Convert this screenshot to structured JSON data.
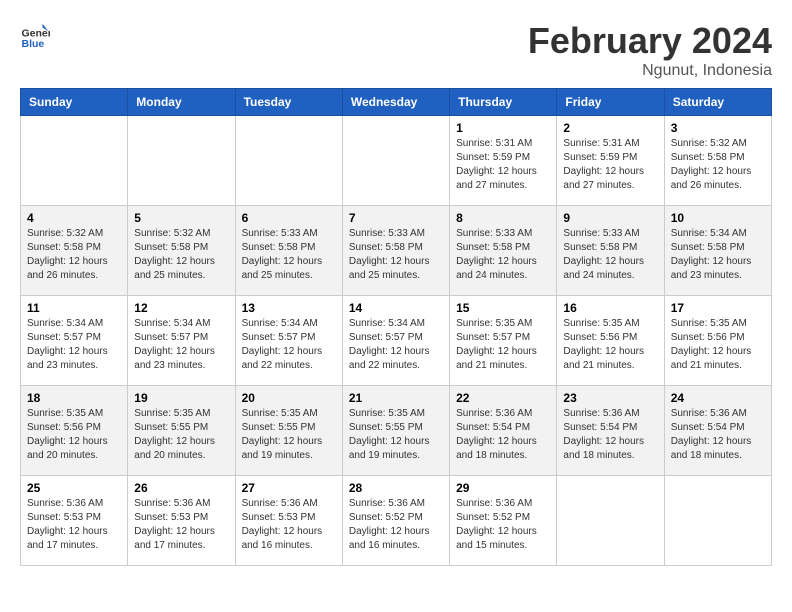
{
  "header": {
    "logo_text_general": "General",
    "logo_text_blue": "Blue",
    "title": "February 2024",
    "subtitle": "Ngunut, Indonesia"
  },
  "days_of_week": [
    "Sunday",
    "Monday",
    "Tuesday",
    "Wednesday",
    "Thursday",
    "Friday",
    "Saturday"
  ],
  "weeks": [
    [
      {
        "day": "",
        "detail": ""
      },
      {
        "day": "",
        "detail": ""
      },
      {
        "day": "",
        "detail": ""
      },
      {
        "day": "",
        "detail": ""
      },
      {
        "day": "1",
        "detail": "Sunrise: 5:31 AM\nSunset: 5:59 PM\nDaylight: 12 hours\nand 27 minutes."
      },
      {
        "day": "2",
        "detail": "Sunrise: 5:31 AM\nSunset: 5:59 PM\nDaylight: 12 hours\nand 27 minutes."
      },
      {
        "day": "3",
        "detail": "Sunrise: 5:32 AM\nSunset: 5:58 PM\nDaylight: 12 hours\nand 26 minutes."
      }
    ],
    [
      {
        "day": "4",
        "detail": "Sunrise: 5:32 AM\nSunset: 5:58 PM\nDaylight: 12 hours\nand 26 minutes."
      },
      {
        "day": "5",
        "detail": "Sunrise: 5:32 AM\nSunset: 5:58 PM\nDaylight: 12 hours\nand 25 minutes."
      },
      {
        "day": "6",
        "detail": "Sunrise: 5:33 AM\nSunset: 5:58 PM\nDaylight: 12 hours\nand 25 minutes."
      },
      {
        "day": "7",
        "detail": "Sunrise: 5:33 AM\nSunset: 5:58 PM\nDaylight: 12 hours\nand 25 minutes."
      },
      {
        "day": "8",
        "detail": "Sunrise: 5:33 AM\nSunset: 5:58 PM\nDaylight: 12 hours\nand 24 minutes."
      },
      {
        "day": "9",
        "detail": "Sunrise: 5:33 AM\nSunset: 5:58 PM\nDaylight: 12 hours\nand 24 minutes."
      },
      {
        "day": "10",
        "detail": "Sunrise: 5:34 AM\nSunset: 5:58 PM\nDaylight: 12 hours\nand 23 minutes."
      }
    ],
    [
      {
        "day": "11",
        "detail": "Sunrise: 5:34 AM\nSunset: 5:57 PM\nDaylight: 12 hours\nand 23 minutes."
      },
      {
        "day": "12",
        "detail": "Sunrise: 5:34 AM\nSunset: 5:57 PM\nDaylight: 12 hours\nand 23 minutes."
      },
      {
        "day": "13",
        "detail": "Sunrise: 5:34 AM\nSunset: 5:57 PM\nDaylight: 12 hours\nand 22 minutes."
      },
      {
        "day": "14",
        "detail": "Sunrise: 5:34 AM\nSunset: 5:57 PM\nDaylight: 12 hours\nand 22 minutes."
      },
      {
        "day": "15",
        "detail": "Sunrise: 5:35 AM\nSunset: 5:57 PM\nDaylight: 12 hours\nand 21 minutes."
      },
      {
        "day": "16",
        "detail": "Sunrise: 5:35 AM\nSunset: 5:56 PM\nDaylight: 12 hours\nand 21 minutes."
      },
      {
        "day": "17",
        "detail": "Sunrise: 5:35 AM\nSunset: 5:56 PM\nDaylight: 12 hours\nand 21 minutes."
      }
    ],
    [
      {
        "day": "18",
        "detail": "Sunrise: 5:35 AM\nSunset: 5:56 PM\nDaylight: 12 hours\nand 20 minutes."
      },
      {
        "day": "19",
        "detail": "Sunrise: 5:35 AM\nSunset: 5:55 PM\nDaylight: 12 hours\nand 20 minutes."
      },
      {
        "day": "20",
        "detail": "Sunrise: 5:35 AM\nSunset: 5:55 PM\nDaylight: 12 hours\nand 19 minutes."
      },
      {
        "day": "21",
        "detail": "Sunrise: 5:35 AM\nSunset: 5:55 PM\nDaylight: 12 hours\nand 19 minutes."
      },
      {
        "day": "22",
        "detail": "Sunrise: 5:36 AM\nSunset: 5:54 PM\nDaylight: 12 hours\nand 18 minutes."
      },
      {
        "day": "23",
        "detail": "Sunrise: 5:36 AM\nSunset: 5:54 PM\nDaylight: 12 hours\nand 18 minutes."
      },
      {
        "day": "24",
        "detail": "Sunrise: 5:36 AM\nSunset: 5:54 PM\nDaylight: 12 hours\nand 18 minutes."
      }
    ],
    [
      {
        "day": "25",
        "detail": "Sunrise: 5:36 AM\nSunset: 5:53 PM\nDaylight: 12 hours\nand 17 minutes."
      },
      {
        "day": "26",
        "detail": "Sunrise: 5:36 AM\nSunset: 5:53 PM\nDaylight: 12 hours\nand 17 minutes."
      },
      {
        "day": "27",
        "detail": "Sunrise: 5:36 AM\nSunset: 5:53 PM\nDaylight: 12 hours\nand 16 minutes."
      },
      {
        "day": "28",
        "detail": "Sunrise: 5:36 AM\nSunset: 5:52 PM\nDaylight: 12 hours\nand 16 minutes."
      },
      {
        "day": "29",
        "detail": "Sunrise: 5:36 AM\nSunset: 5:52 PM\nDaylight: 12 hours\nand 15 minutes."
      },
      {
        "day": "",
        "detail": ""
      },
      {
        "day": "",
        "detail": ""
      }
    ]
  ]
}
